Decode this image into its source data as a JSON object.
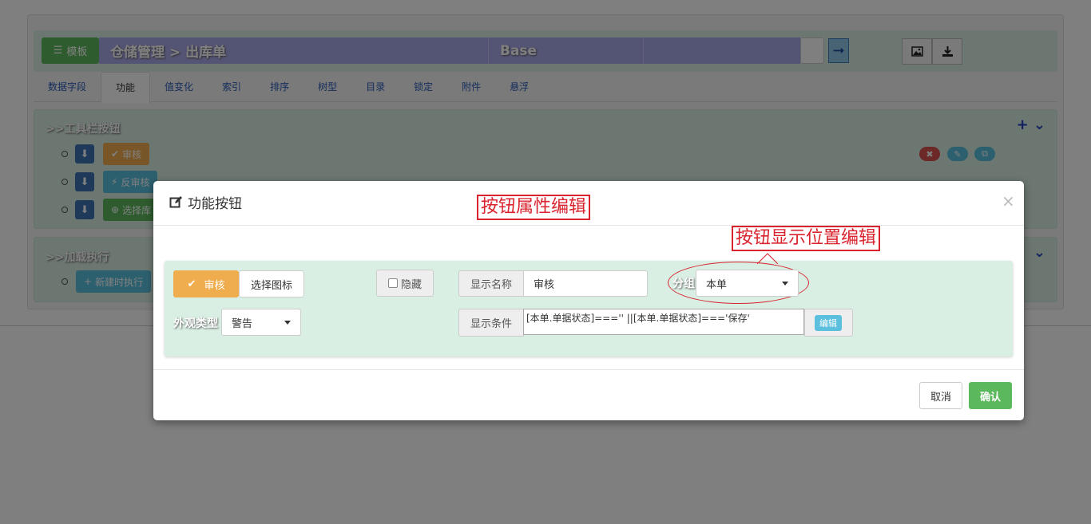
{
  "header": {
    "template_label": "模板",
    "breadcrumb": "仓储管理 > 出库单",
    "base_label": "Base"
  },
  "tabs": [
    "数据字段",
    "功能",
    "值变化",
    "索引",
    "排序",
    "树型",
    "目录",
    "锁定",
    "附件",
    "悬浮"
  ],
  "sections": {
    "toolbar_title": ">>工具栏按钮",
    "toolbar_items": [
      "审核",
      "反审核",
      "选择库"
    ],
    "async_title": ">>加载执行",
    "async_item": "新建时执行"
  },
  "colors": {
    "success": "#5cb85c",
    "warning": "#f0ad4e",
    "info": "#5bc0de",
    "primary": "#3e73b7",
    "danger": "#d9534f",
    "annotation_red": "#d9232e"
  },
  "modal": {
    "title": "功能按钮",
    "close": "×",
    "preview_button": "审核",
    "choose_icon": "选择图标",
    "hide_label": "隐藏",
    "display_name_label": "显示名称",
    "display_name_value": "审核",
    "group_label": "分组",
    "group_value": "本单",
    "appearance_label": "外观类型",
    "appearance_value": "警告",
    "condition_label": "显示条件",
    "condition_value": "[本单.单据状态]==='' ||[本单.单据状态]==='保存'",
    "edit_button": "编辑",
    "cancel_button": "取消",
    "confirm_button": "确认"
  },
  "annotations": {
    "attr_edit": "按钮属性编辑",
    "position_edit": "按钮显示位置编辑"
  }
}
